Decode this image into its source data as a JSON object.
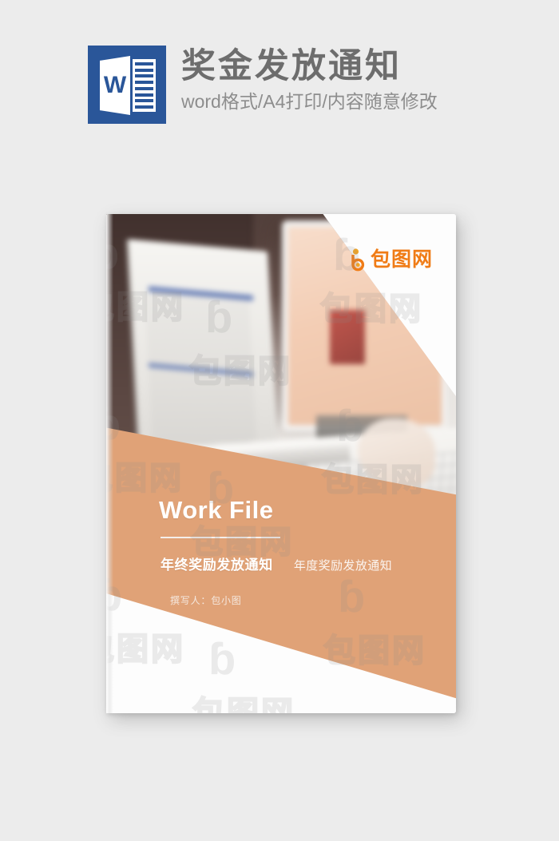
{
  "header": {
    "icon_name": "word-file-icon",
    "icon_letter": "W",
    "title": "奖金发放通知",
    "subtitle": "word格式/A4打印/内容随意修改",
    "title_color": "#6d6d6d",
    "subtitle_color": "#8d8d8d",
    "icon_color": "#2a5699"
  },
  "cover": {
    "brand": {
      "mark_name": "baotu-b-mark",
      "text": "包图网",
      "color": "#f07c16"
    },
    "headline": "Work File",
    "subtitle_main": "年终奖励发放通知",
    "subtitle_alt": "年度奖励发放通知",
    "author": "撰写人：包小图",
    "band_color": "#e0a277",
    "paper_color": "#fdfdfd",
    "text_color": "#ffffff"
  },
  "watermark": {
    "mark": "ɓ",
    "text": "包图网"
  },
  "background": {
    "color": "#ececec"
  }
}
